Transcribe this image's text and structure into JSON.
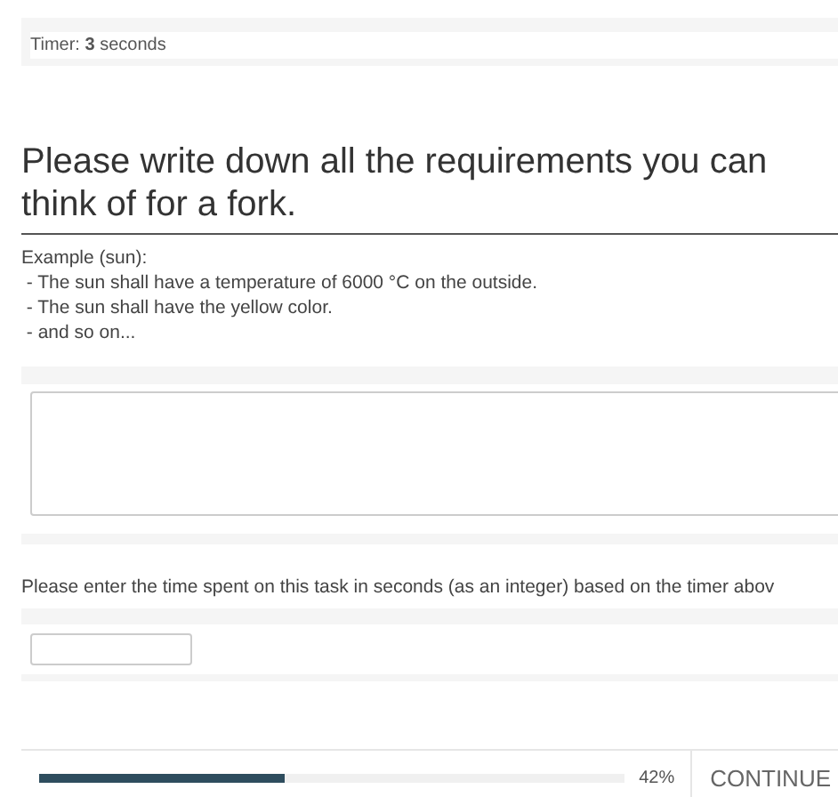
{
  "timer": {
    "text": "Timer: **3** seconds"
  },
  "question": {
    "title": "Please write down all the requirements you can think of for a fork.",
    "example_lines": [
      "Example (sun):",
      " - The sun shall have a temperature of 6000 °C on the outside.",
      " - The sun shall have the yellow color.",
      " - and so on..."
    ]
  },
  "time_prompt": "Please enter the time spent on this task in seconds (as an integer) based on the timer abov",
  "footer": {
    "progress": {
      "level": 0.42,
      "reading": "42%"
    },
    "continue_button": "CONTINUE"
  }
}
